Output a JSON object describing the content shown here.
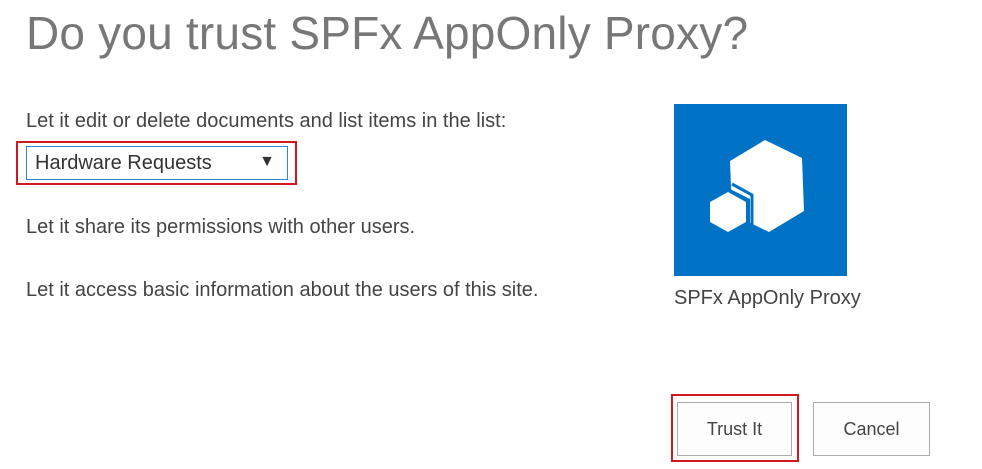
{
  "dialog": {
    "title": "Do you trust SPFx AppOnly Proxy?"
  },
  "permissions": {
    "list_permission": "Let it edit or delete documents and list items in the list:",
    "share_permission": "Let it share its permissions with other users.",
    "users_permission": "Let it access basic information about the users of this site."
  },
  "list_select": {
    "selected": "Hardware Requests",
    "arrow_icon": "▼"
  },
  "app": {
    "name": "SPFx AppOnly Proxy",
    "tile_color": "#0072c6",
    "icon": "hexagon-cubes-icon"
  },
  "buttons": {
    "trust": "Trust It",
    "cancel": "Cancel"
  },
  "highlight_color": "#d0191e"
}
